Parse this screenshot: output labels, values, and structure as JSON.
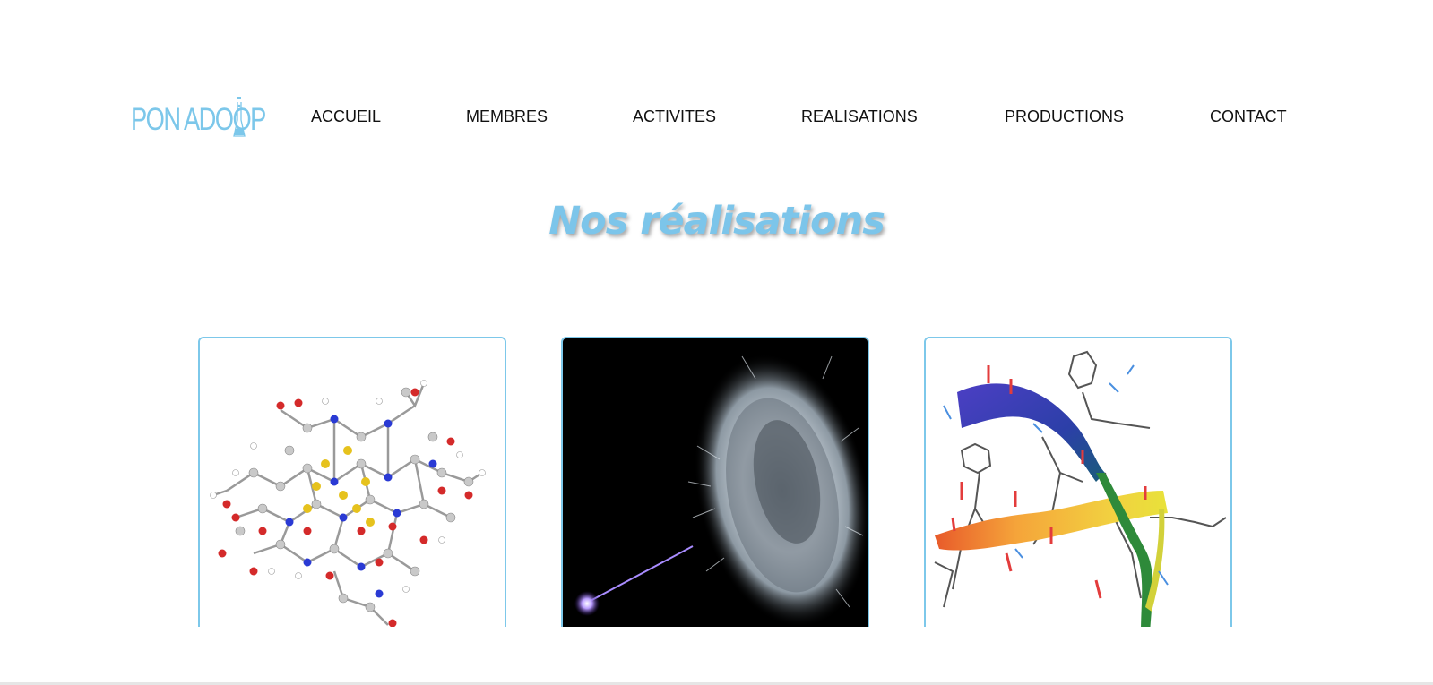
{
  "logo": {
    "text": "PON ADOOP",
    "icon": "flask-icon"
  },
  "nav": {
    "items": [
      "ACCUEIL",
      "MEMBRES",
      "ACTIVITES",
      "REALISATIONS",
      "PRODUCTIONS",
      "CONTACT"
    ]
  },
  "page_title": "Nos réalisations",
  "cards": [
    {
      "image": "molecule-ball-stick-image"
    },
    {
      "image": "laser-particle-explosion-image"
    },
    {
      "image": "protein-ribbon-structure-image"
    }
  ],
  "colors": {
    "accent": "#7cc7ea",
    "nav_text": "#111111",
    "card_border": "#7dc8ea"
  }
}
